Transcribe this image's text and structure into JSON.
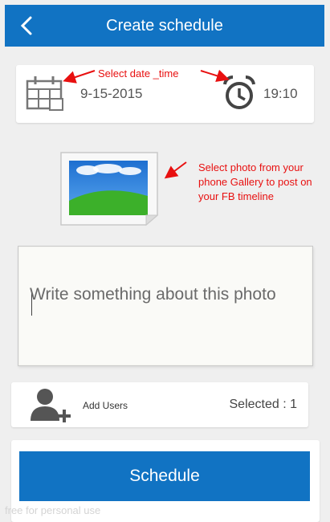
{
  "header": {
    "title": "Create schedule",
    "back_icon": "chevron-left-icon",
    "color": "#1173c3"
  },
  "schedule_time": {
    "date": "9-15-2015",
    "time": "19:10",
    "calendar_icon": "calendar-icon",
    "alarm_icon": "alarm-clock-icon"
  },
  "annotations": {
    "date_time": "Select date _time",
    "photo": [
      "Select photo from your",
      "phone Gallery to post on",
      "your FB timeline"
    ],
    "color": "#e81010"
  },
  "photo": {
    "icon": "image-placeholder-icon"
  },
  "caption": {
    "placeholder": "Write something about this photo",
    "value": ""
  },
  "users": {
    "icon": "add-user-icon",
    "add_label": "Add Users",
    "selected_text": "Selected : 1"
  },
  "actions": {
    "schedule_label": "Schedule"
  },
  "watermark": "free for personal use"
}
